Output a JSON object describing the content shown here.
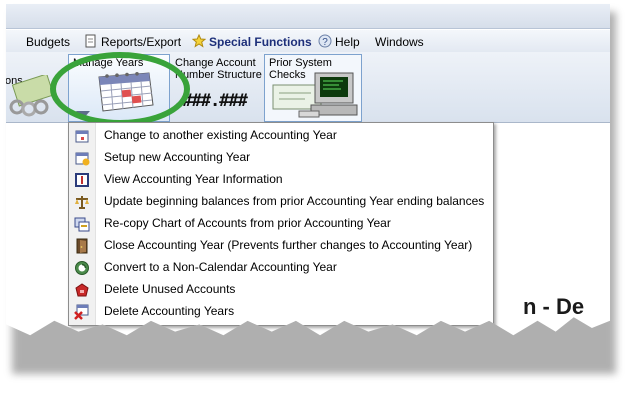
{
  "menubar": {
    "items": [
      {
        "label": "Budgets",
        "icon": null
      },
      {
        "label": "Reports/Export",
        "icon": "document-icon"
      },
      {
        "label": "Special Functions",
        "icon": "star-icon"
      },
      {
        "label": "Help",
        "icon": "help-icon"
      },
      {
        "label": "Windows",
        "icon": null
      }
    ]
  },
  "ribbon": {
    "partial_left_label": "ons",
    "manage_years_label": "Manage Years",
    "change_account_label_1": "Change Account",
    "change_account_label_2": "Number Structure",
    "account_pattern": ".###.###",
    "prior_checks_label_1": "Prior System",
    "prior_checks_label_2": "Checks"
  },
  "dropdown": {
    "items": [
      {
        "label": "Change to another existing Accounting Year",
        "icon": "calendar-switch-icon"
      },
      {
        "label": "Setup new Accounting Year",
        "icon": "calendar-add-icon"
      },
      {
        "label": "View Accounting Year Information",
        "icon": "info-icon"
      },
      {
        "label": "Update beginning balances from prior Accounting Year ending balances",
        "icon": "scales-icon"
      },
      {
        "label": "Re-copy Chart of Accounts from prior Accounting Year",
        "icon": "copy-chart-icon"
      },
      {
        "label": "Close Accounting Year (Prevents further changes to Accounting Year)",
        "icon": "door-icon"
      },
      {
        "label": "Convert to a Non-Calendar Accounting Year",
        "icon": "convert-icon"
      },
      {
        "label": "Delete Unused Accounts",
        "icon": "delete-accounts-icon"
      },
      {
        "label": "Delete Accounting Years",
        "icon": "delete-years-icon"
      }
    ]
  },
  "background_text": "n - De",
  "colors": {
    "highlight_circle": "#39a33a",
    "special_functions": "#1d2f7a"
  }
}
